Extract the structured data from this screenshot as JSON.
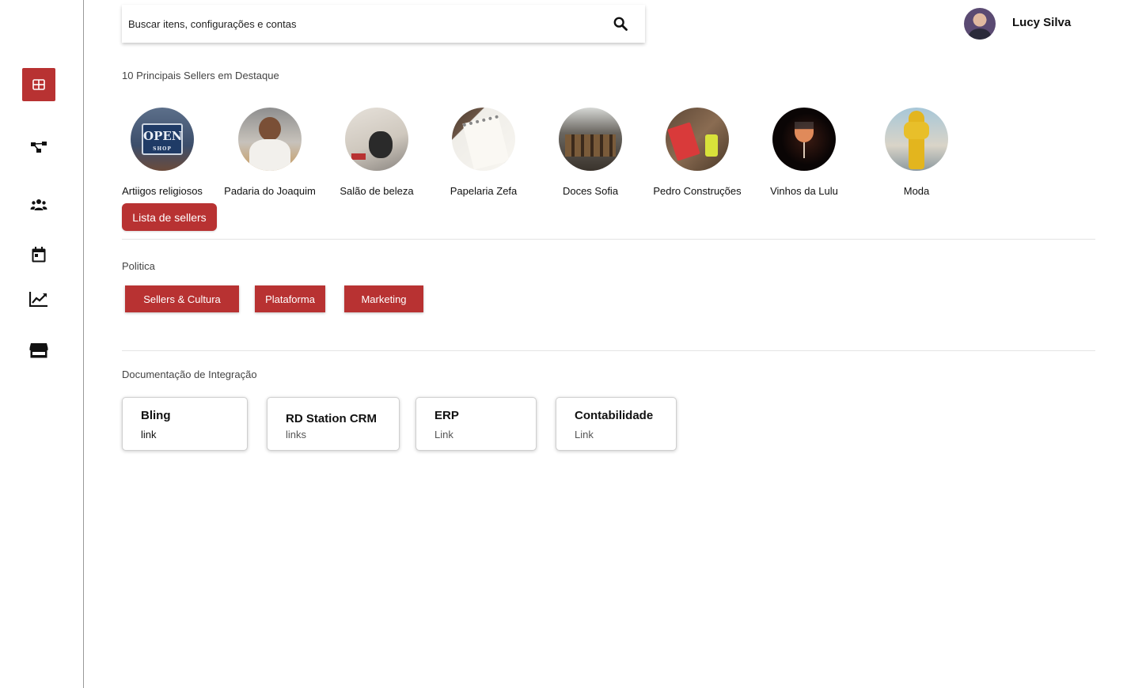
{
  "search": {
    "placeholder": "Buscar itens, configurações e contas"
  },
  "user": {
    "name": "Lucy Silva"
  },
  "sidebar": {
    "items": [
      {
        "icon": "dashboard-icon",
        "active": true
      },
      {
        "icon": "share-network-icon",
        "active": false
      },
      {
        "icon": "users-group-icon",
        "active": false
      },
      {
        "icon": "calendar-icon",
        "active": false
      },
      {
        "icon": "trending-chart-icon",
        "active": false
      },
      {
        "icon": "store-icon",
        "active": false
      }
    ]
  },
  "sellers": {
    "title": "10 Principais Sellers em Destaque",
    "items": [
      {
        "name": "Artiigos religiosos"
      },
      {
        "name": "Padaria do Joaquim"
      },
      {
        "name": "Salão de beleza"
      },
      {
        "name": "Papelaria Zefa"
      },
      {
        "name": "Doces Sofia"
      },
      {
        "name": "Pedro Construções"
      },
      {
        "name": "Vinhos da Lulu"
      },
      {
        "name": "Moda"
      }
    ],
    "list_button": "Lista de sellers"
  },
  "politica": {
    "title": "Politica",
    "buttons": [
      "Sellers & Cultura",
      "Plataforma",
      "Marketing"
    ]
  },
  "docs": {
    "title": "Documentação de Integração",
    "cards": [
      {
        "title": "Bling",
        "link": "link"
      },
      {
        "title": "RD Station CRM",
        "link": "links"
      },
      {
        "title": "ERP",
        "link": "Link"
      },
      {
        "title": "Contabilidade",
        "link": "Link"
      }
    ]
  },
  "colors": {
    "accent": "#b83232"
  }
}
